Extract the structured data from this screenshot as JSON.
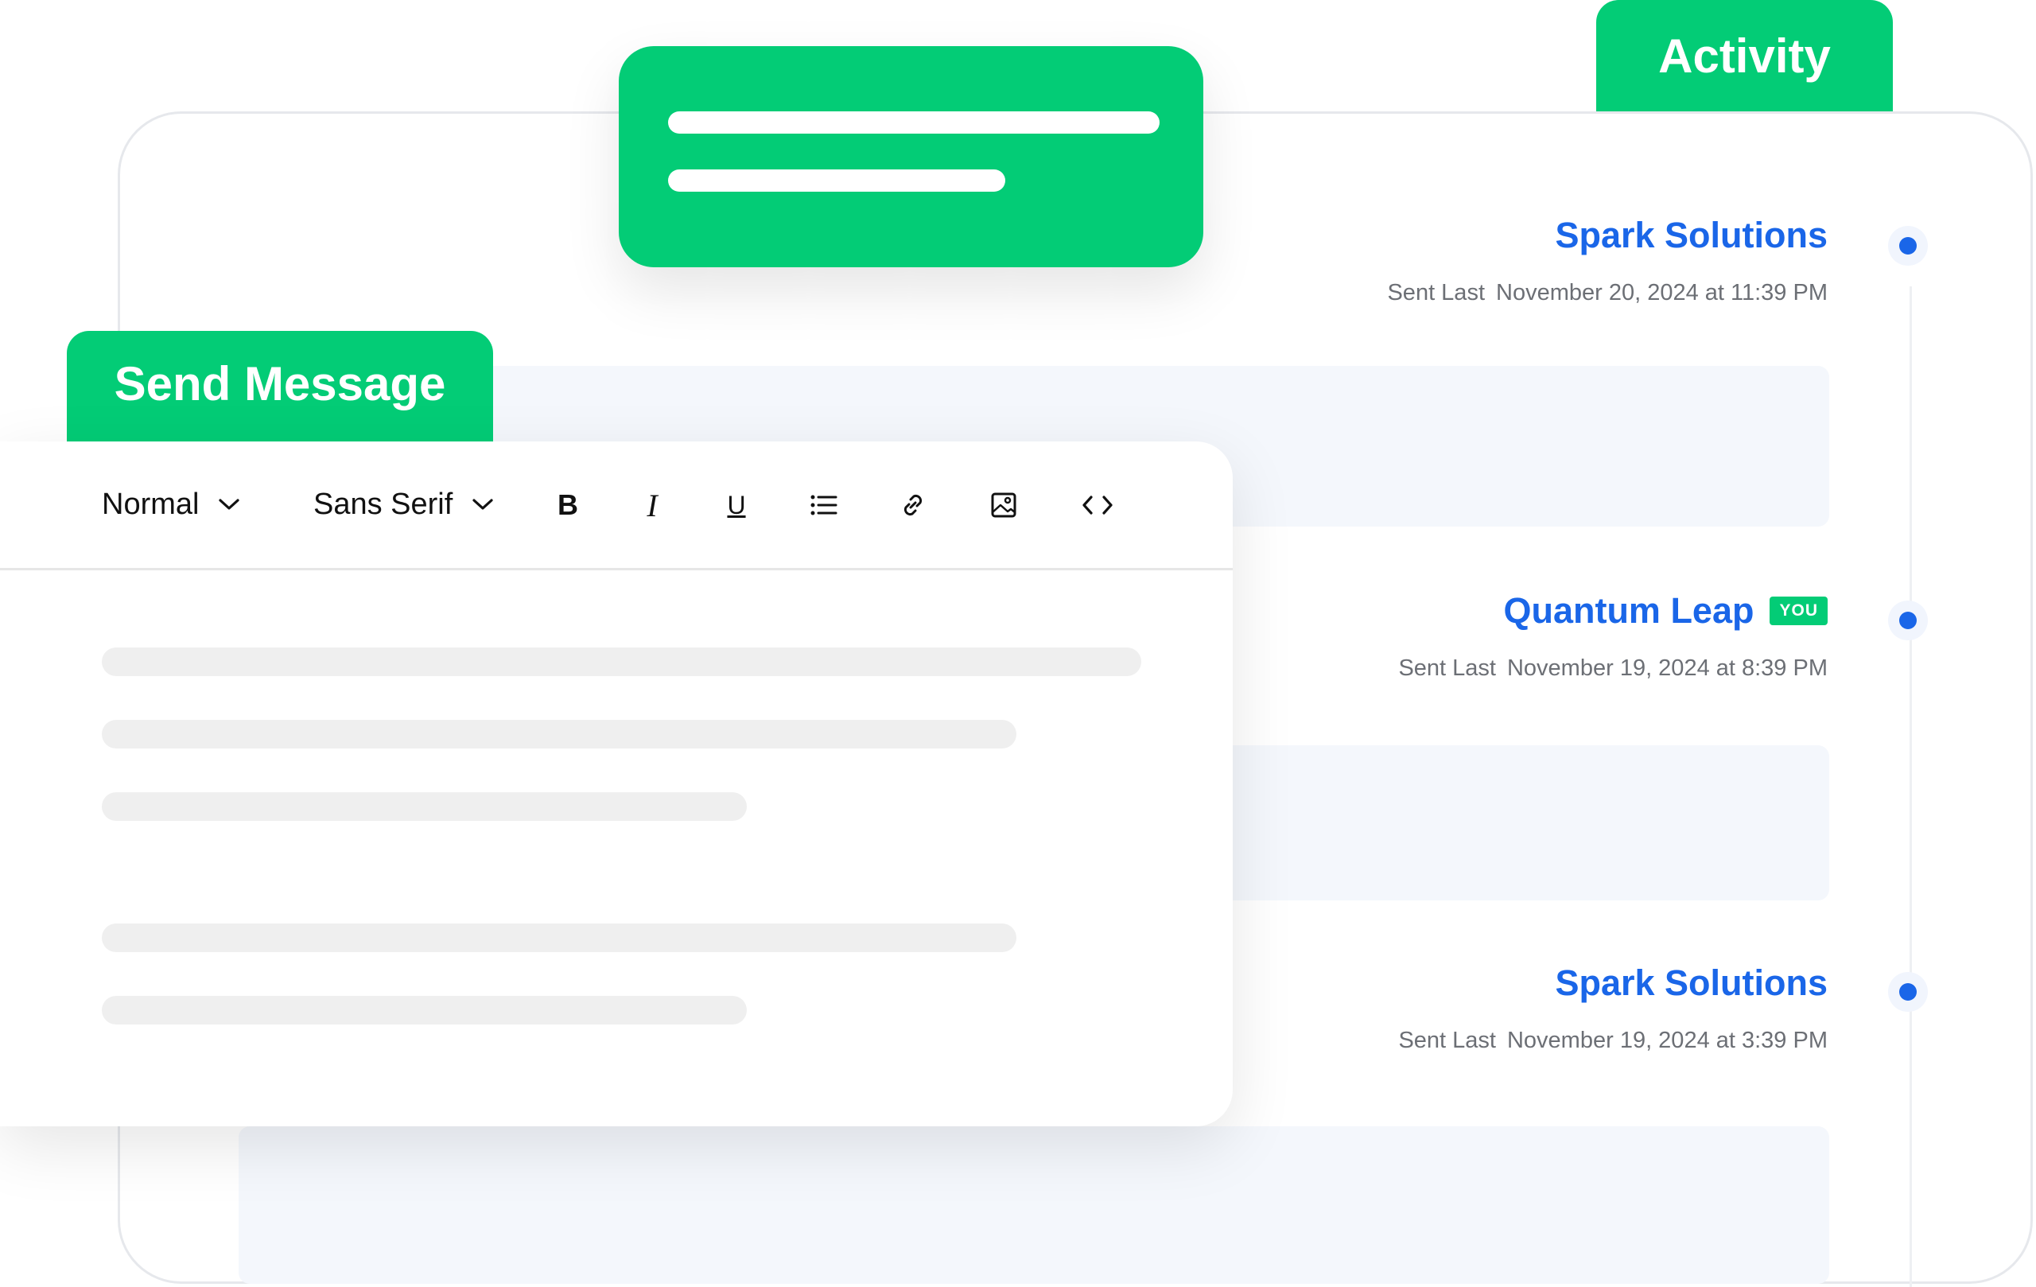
{
  "activity": {
    "tab_label": "Activity",
    "entries": [
      {
        "name": "Spark Solutions",
        "badge": "",
        "meta_label": "Sent Last",
        "date": "November 20, 2024 at 11:39 PM"
      },
      {
        "name": "Quantum Leap",
        "badge": "YOU",
        "meta_label": "Sent Last",
        "date": "November 19, 2024 at 8:39 PM"
      },
      {
        "name": "Spark Solutions",
        "badge": "",
        "meta_label": "Sent Last",
        "date": "November 19, 2024 at 3:39 PM"
      }
    ]
  },
  "editor": {
    "tab_label": "Send Message",
    "toolbar": {
      "format_select": "Normal",
      "font_select": "Sans Serif",
      "bold": "B",
      "italic": "I",
      "underline": "U",
      "list": "bullet-list-icon",
      "link": "link-icon",
      "image": "image-icon",
      "code": "code-icon"
    }
  },
  "colors": {
    "accent_green": "#03cc76",
    "link_blue": "#1a66e8",
    "meta_gray": "#6c6f75"
  }
}
